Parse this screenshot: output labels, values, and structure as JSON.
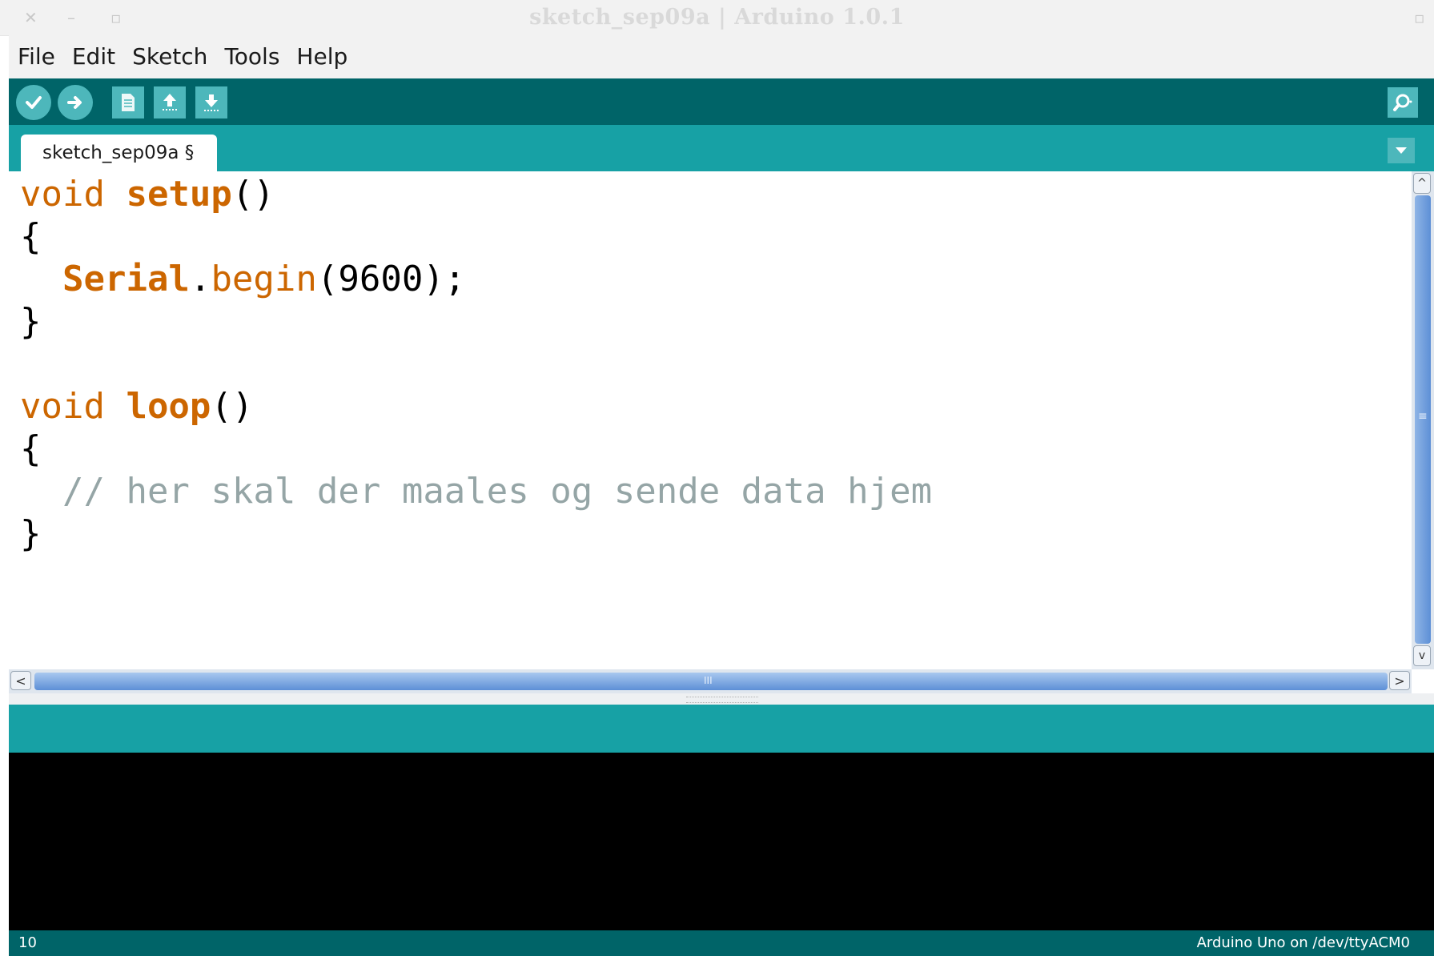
{
  "window": {
    "title": "sketch_sep09a | Arduino 1.0.1",
    "controls": {
      "close": "✕",
      "minimize": "–",
      "maximize": "▫",
      "right": "▫"
    }
  },
  "menu": {
    "items": [
      "File",
      "Edit",
      "Sketch",
      "Tools",
      "Help"
    ]
  },
  "toolbar": {
    "buttons": [
      "verify-icon",
      "upload-icon",
      "new-icon",
      "open-icon",
      "save-icon"
    ],
    "right_button": "serial-monitor-icon"
  },
  "tabs": [
    {
      "label": "sketch_sep09a §",
      "active": true
    }
  ],
  "editor": {
    "lines": [
      [
        {
          "t": "void ",
          "c": "kw"
        },
        {
          "t": "setup",
          "c": "kwb"
        },
        {
          "t": "()",
          "c": ""
        }
      ],
      [
        {
          "t": "{",
          "c": ""
        }
      ],
      [
        {
          "t": "  ",
          "c": ""
        },
        {
          "t": "Serial",
          "c": "kwb"
        },
        {
          "t": ".",
          "c": ""
        },
        {
          "t": "begin",
          "c": "kw"
        },
        {
          "t": "(9600);",
          "c": ""
        }
      ],
      [
        {
          "t": "}",
          "c": ""
        }
      ],
      [
        {
          "t": "",
          "c": ""
        }
      ],
      [
        {
          "t": "void ",
          "c": "kw"
        },
        {
          "t": "loop",
          "c": "kwb"
        },
        {
          "t": "()",
          "c": ""
        }
      ],
      [
        {
          "t": "{",
          "c": ""
        }
      ],
      [
        {
          "t": "  ",
          "c": ""
        },
        {
          "t": "// her skal der maales og sende data hjem",
          "c": "cm"
        }
      ],
      [
        {
          "t": "}",
          "c": ""
        }
      ]
    ]
  },
  "scrollbars": {
    "vertical": {
      "up": "^",
      "down": "v",
      "grip": "≡"
    },
    "horizontal": {
      "left": "<",
      "right": ">",
      "grip": "III"
    }
  },
  "status": {
    "message": "",
    "line_number": "10",
    "board": "Arduino Uno on /dev/ttyACM0"
  },
  "colors": {
    "toolbar": "#006468",
    "tabstrip": "#17a1a5",
    "button": "#4db7bb",
    "keyword": "#cc6600",
    "comment": "#95a5a6",
    "console": "#000000"
  }
}
